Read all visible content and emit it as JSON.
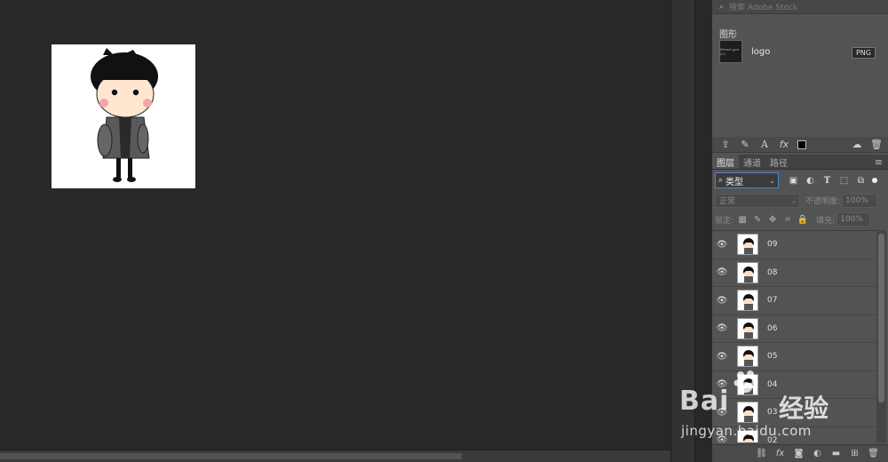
{
  "stock_search": {
    "placeholder": "搜索 Adobe Stock"
  },
  "library": {
    "group_title": "图形",
    "items": [
      {
        "name": "logo",
        "badge": "PNG",
        "thumb_text": "Power you (2)"
      }
    ]
  },
  "layers_panel": {
    "tabs": [
      {
        "label": "图层",
        "active": true
      },
      {
        "label": "通道",
        "active": false
      },
      {
        "label": "路径",
        "active": false
      }
    ],
    "filter": {
      "selected": "类型"
    },
    "blend_mode": "正常",
    "opacity_label": "不透明度:",
    "opacity_value": "100%",
    "lock_label": "锁定:",
    "fill_label": "填充:",
    "fill_value": "100%",
    "layers": [
      {
        "name": "09",
        "visible": true
      },
      {
        "name": "08",
        "visible": true
      },
      {
        "name": "07",
        "visible": true
      },
      {
        "name": "06",
        "visible": true
      },
      {
        "name": "05",
        "visible": true
      },
      {
        "name": "04",
        "visible": true
      },
      {
        "name": "03",
        "visible": true
      },
      {
        "name": "02",
        "visible": true
      }
    ]
  },
  "icons": {
    "eye": "eye-icon",
    "search": "search-icon",
    "menu": "panel-menu-icon"
  },
  "watermark": {
    "brand": "Bai",
    "brand_suffix": "经验",
    "url": "jingyan.baidu.com"
  }
}
